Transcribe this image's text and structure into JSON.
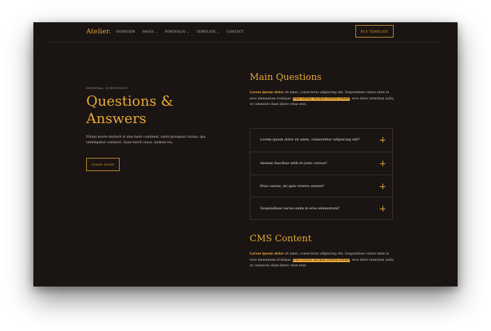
{
  "nav": {
    "logo": "Atelier.",
    "menu": [
      "OVERVIEW",
      "PAGES ⌄",
      "PORTFOLIO ⌄",
      "TEMPLATE ⌄",
      "CONTACT"
    ],
    "buy_label": "BUY TEMPLATE"
  },
  "hero": {
    "eyebrow": "GENERAL QUESTIONS",
    "title_line1": "Questions &",
    "title_line2": "Answers",
    "text": "Filium morte multavit si sine metu continent, saluti prospexit civium, qua intellegebat contineri. Quae fuerit causa, mollem res.",
    "learn_more": "LEARN MORE"
  },
  "main_questions": {
    "title": "Main Questions",
    "bold": "Lorem ipsum dolor",
    "text1": " sit amet, consectetur adipiscing elit. Suspendisse varius enim in eros elementum tristique. ",
    "highlight": "Duis cursus, mi quis viverra ornare",
    "text2": ", eros dolor interdum nulla, ut commodo diam libero vitae erat."
  },
  "faq": [
    "Lorem ipsum dolor sit amet, consectetur adipiscing elit?",
    "Aenean faucibus nibh et justo cursus?",
    "Duis cursus, mi quis viverra ornare?",
    "Suspendisse varius enim in eros elementum?"
  ],
  "cms_content": {
    "title": "CMS Content",
    "bold": "Lorem ipsum dolor",
    "text1": " sit amet, consectetur adipiscing elit. Suspendisse varius enim in eros elementum tristique. ",
    "highlight": "Duis cursus, mi quis viverra ornare",
    "text2": ", eros dolor interdum nulla, ut commodo diam libero vitae erat."
  },
  "colors": {
    "background": "#1a1513",
    "accent": "#e8a93a",
    "text": "#cfc5bb"
  },
  "icons": {
    "faq_toggle": "plus-icon"
  }
}
